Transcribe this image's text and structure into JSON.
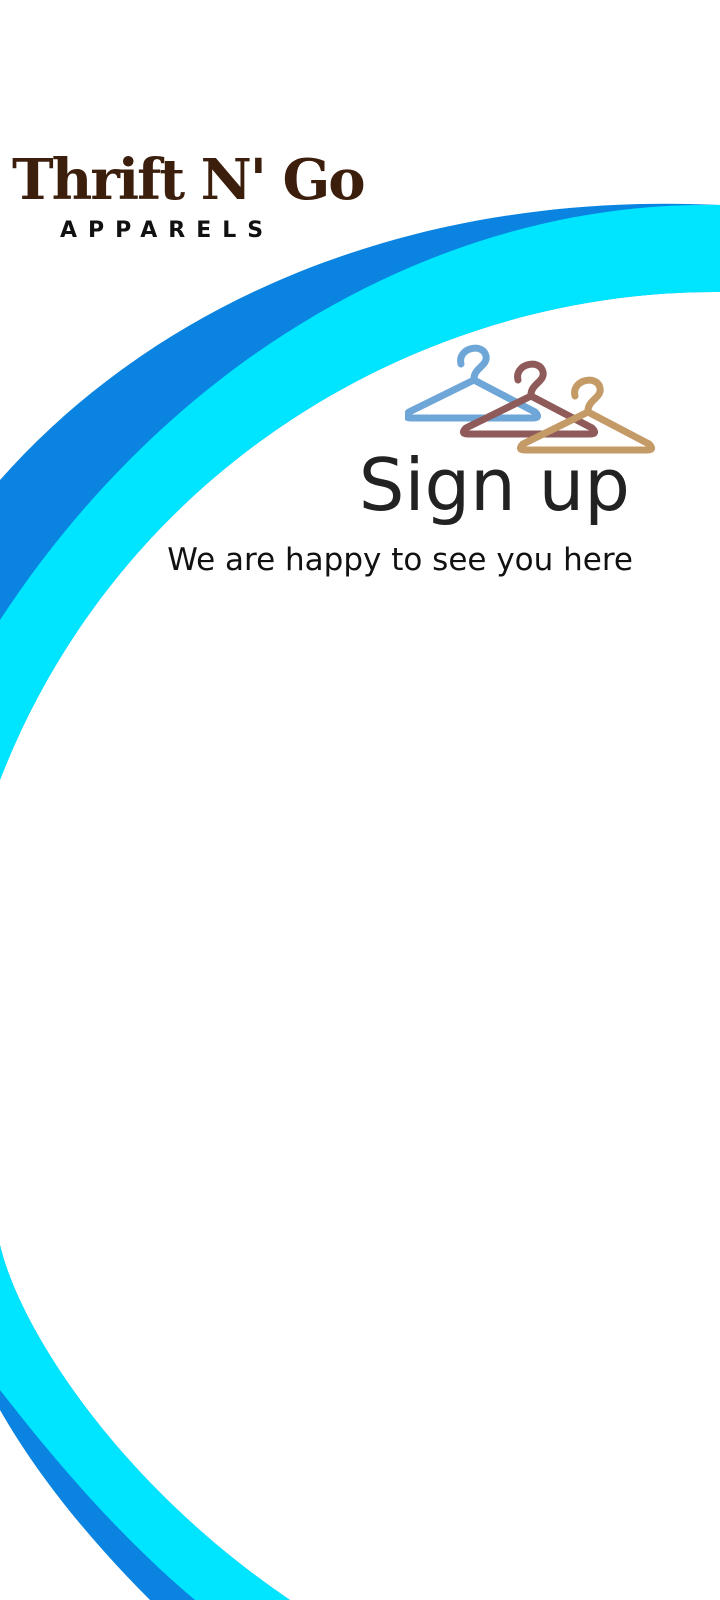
{
  "brand": {
    "name": "Thrift N' Go",
    "tagline": "APPARELS"
  },
  "signup": {
    "title": "Sign up",
    "subtitle": "We are happy to see you here"
  },
  "icons": {
    "background": "swoosh-decoration",
    "illustration": "clothes-hanger-icon"
  },
  "colors": {
    "background": "#ffffff",
    "swoosh_dark": "#0a84e0",
    "swoosh_light": "#00e5ff",
    "brand_text": "#3b1e0c",
    "tagline_text": "#111111",
    "title_text": "#222222",
    "subtitle_text": "#111111",
    "hanger_blue": "#6fa6d8",
    "hanger_maroon": "#8e5a5a",
    "hanger_tan": "#c49a66"
  }
}
